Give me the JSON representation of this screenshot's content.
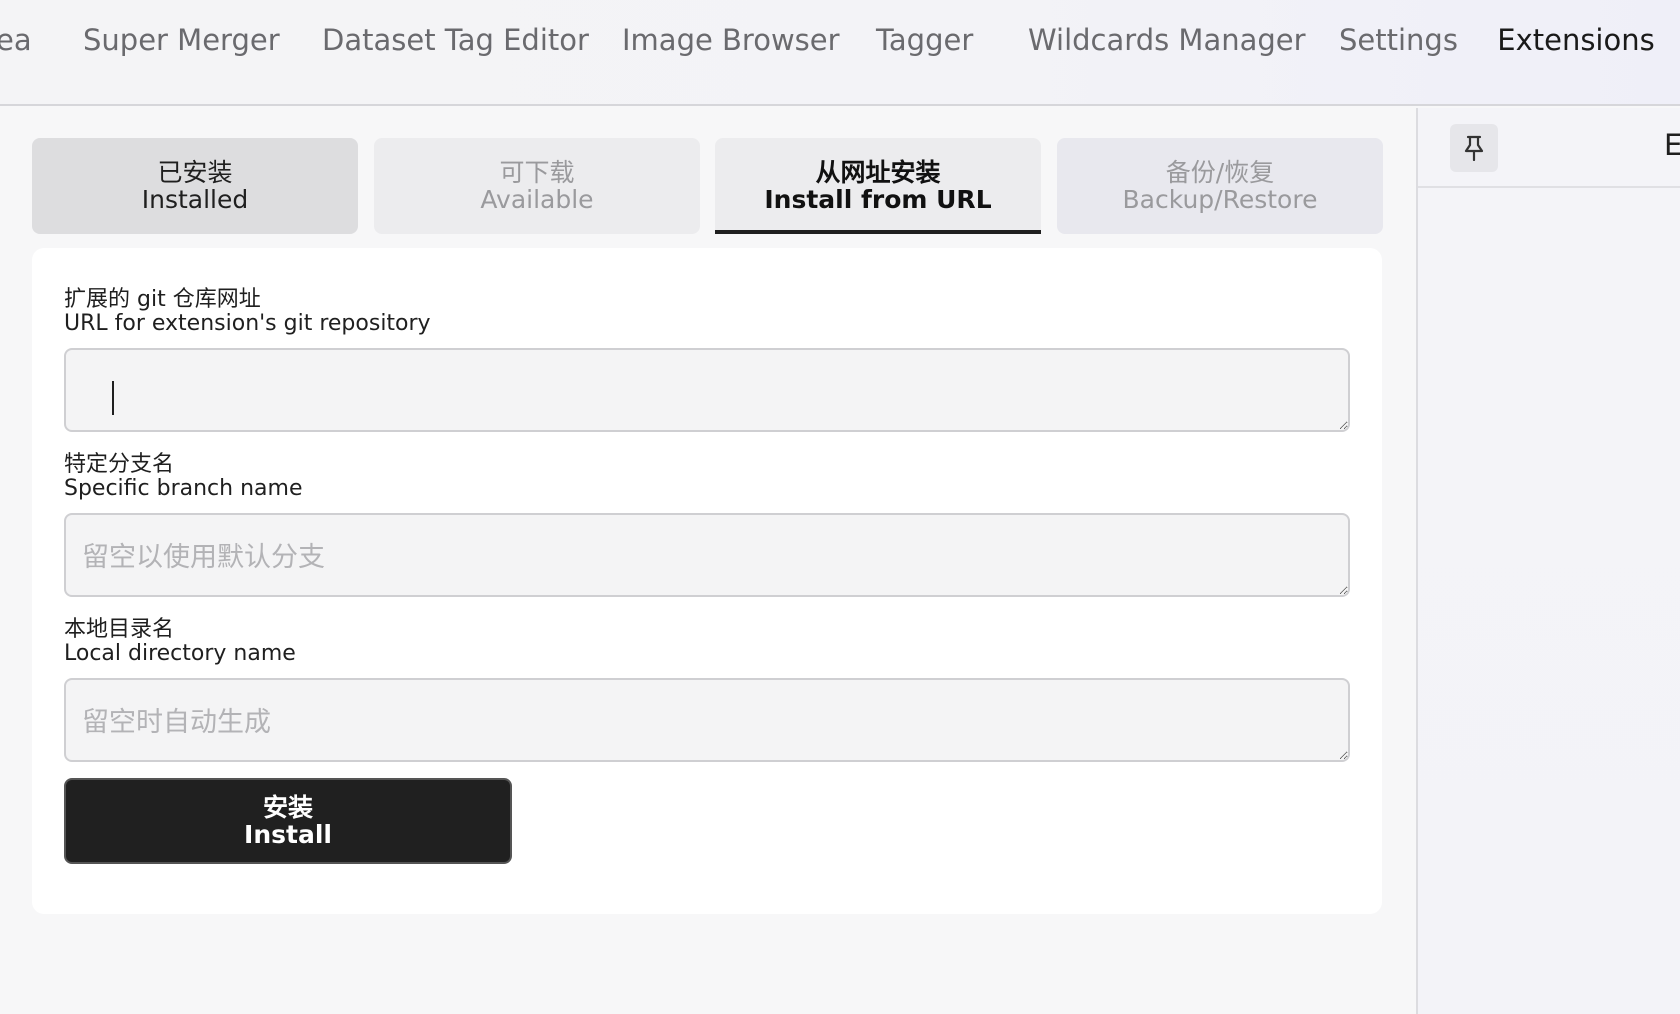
{
  "top_tabs": [
    {
      "label": "ea"
    },
    {
      "label": "Super Merger"
    },
    {
      "label": "Dataset Tag Editor"
    },
    {
      "label": "Image Browser"
    },
    {
      "label": "Tagger"
    },
    {
      "label": "Wildcards Manager"
    },
    {
      "label": "Settings"
    },
    {
      "label": "Extensions",
      "active": true
    }
  ],
  "sub_tabs": {
    "installed": {
      "zh": "已安装",
      "en": "Installed"
    },
    "available": {
      "zh": "可下载",
      "en": "Available"
    },
    "install_from_url": {
      "zh": "从网址安装",
      "en": "Install from URL",
      "active": true
    },
    "backup_restore": {
      "zh": "备份/恢复",
      "en": "Backup/Restore"
    }
  },
  "form": {
    "git_url": {
      "label_zh": "扩展的 git 仓库网址",
      "label_en": "URL for extension's git repository",
      "value": "",
      "placeholder": ""
    },
    "branch": {
      "label_zh": "特定分支名",
      "label_en": "Specific branch name",
      "value": "",
      "placeholder": "留空以使用默认分支"
    },
    "local_dir": {
      "label_zh": "本地目录名",
      "label_en": "Local directory name",
      "value": "",
      "placeholder": "留空时自动生成"
    },
    "install_button": {
      "zh": "安装",
      "en": "Install"
    }
  },
  "sidebar": {
    "pin_icon": "pin-icon",
    "title_fragment": "E"
  },
  "colors": {
    "accent": "#1f1f1f",
    "button_bg": "#202020",
    "panel_bg": "#ffffff"
  }
}
